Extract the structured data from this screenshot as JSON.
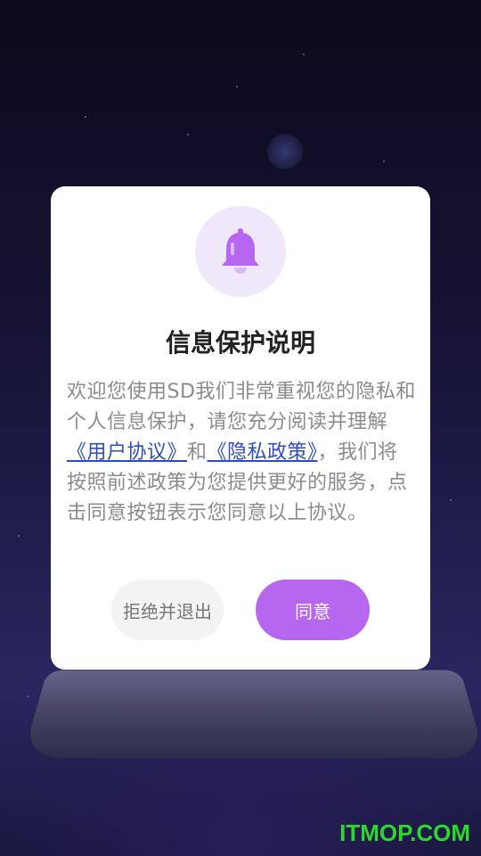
{
  "dialog": {
    "icon": "bell-icon",
    "title": "信息保护说明",
    "text_1": "欢迎您使用SD我们非常重视您的隐私和个人信息保护，请您充分阅读并理解",
    "link_user_agreement": "《用户协议》",
    "text_and": "和",
    "link_privacy_policy": "《隐私政策》",
    "text_2": "，我们将按照前述政策为您提供更好的服务，点击同意按钮表示您同意以上协议。",
    "reject_label": "拒绝并退出",
    "agree_label": "同意"
  },
  "watermark": "ITMOP.COM",
  "colors": {
    "accent": "#b766ef",
    "bell": "#b766ef",
    "bell_bg": "#efe8fb",
    "link": "#2f4bc4"
  }
}
